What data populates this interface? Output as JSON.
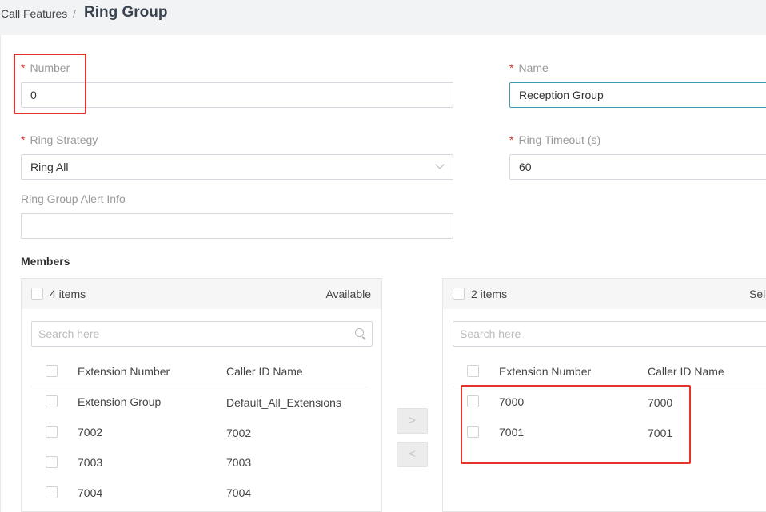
{
  "breadcrumb": {
    "parent": "Call Features",
    "separator": "/",
    "current": "Ring Group"
  },
  "form": {
    "number": {
      "label": "Number",
      "required": "*",
      "value": "0"
    },
    "name": {
      "label": "Name",
      "required": "*",
      "value": "Reception Group"
    },
    "ring_strategy": {
      "label": "Ring Strategy",
      "required": "*",
      "value": "Ring All"
    },
    "ring_timeout": {
      "label": "Ring Timeout (s)",
      "required": "*",
      "value": "60"
    },
    "alert_info": {
      "label": "Ring Group Alert Info",
      "value": ""
    }
  },
  "members": {
    "title": "Members",
    "available": {
      "count": "4 items",
      "title": "Available",
      "search_placeholder": "Search here",
      "columns": [
        "Extension Number",
        "Caller ID Name"
      ],
      "rows": [
        {
          "ext": "Extension Group",
          "name": "Default_All_Extensions"
        },
        {
          "ext": "7002",
          "name": "7002"
        },
        {
          "ext": "7003",
          "name": "7003"
        },
        {
          "ext": "7004",
          "name": "7004"
        }
      ]
    },
    "selected": {
      "count": "2 items",
      "title": "Sele",
      "search_placeholder": "Search here",
      "columns": [
        "Extension Number",
        "Caller ID Name"
      ],
      "rows": [
        {
          "ext": "7000",
          "name": "7000"
        },
        {
          "ext": "7001",
          "name": "7001"
        }
      ]
    },
    "move_right": ">",
    "move_left": "<"
  },
  "colors": {
    "required": "#e0322b",
    "annotation": "#e5322d",
    "focus_border": "#3c9cb0"
  }
}
